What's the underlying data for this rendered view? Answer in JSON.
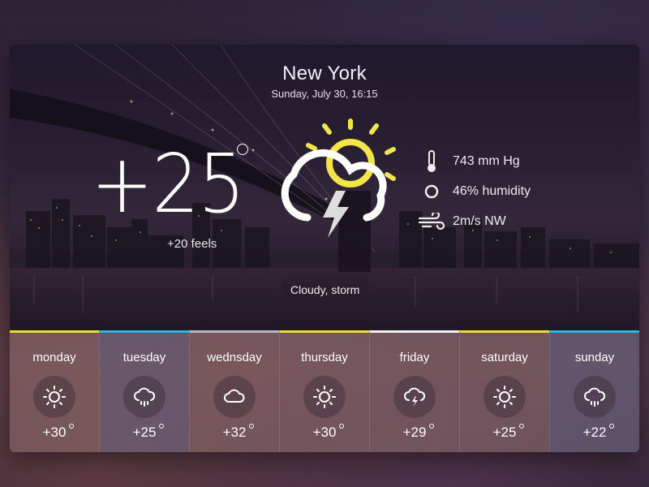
{
  "location": {
    "city": "New York",
    "datetime": "Sunday, July 30, 16:15"
  },
  "current": {
    "temperature": "+25",
    "feels": "+20 feels",
    "condition": "Cloudy, storm",
    "icon": "sun-cloud-storm-icon"
  },
  "stats": [
    {
      "icon": "thermometer-icon",
      "text": "743 mm Hg"
    },
    {
      "icon": "humidity-icon",
      "text": "46% humidity"
    },
    {
      "icon": "wind-icon",
      "text": "2m/s NW"
    }
  ],
  "forecast": [
    {
      "day": "monday",
      "temp": "+30",
      "icon": "sun-icon",
      "accent": "#e9e02a"
    },
    {
      "day": "tuesday",
      "temp": "+25",
      "icon": "rain-cloud-icon",
      "accent": "#27b7e6"
    },
    {
      "day": "wednsday",
      "temp": "+32",
      "icon": "cloud-icon",
      "accent": "#b9b4c4"
    },
    {
      "day": "thursday",
      "temp": "+30",
      "icon": "sun-icon",
      "accent": "#e9e02a"
    },
    {
      "day": "friday",
      "temp": "+29",
      "icon": "storm-cloud-icon",
      "accent": "#f2f2f2"
    },
    {
      "day": "saturday",
      "temp": "+25",
      "icon": "sun-icon",
      "accent": "#e9e02a"
    },
    {
      "day": "sunday",
      "temp": "+22",
      "icon": "rain-cloud-icon",
      "accent": "#27b7e6"
    }
  ],
  "colors": {
    "sun": "#f3e44a",
    "accent_yellow": "#e9e02a",
    "accent_blue": "#27b7e6"
  }
}
